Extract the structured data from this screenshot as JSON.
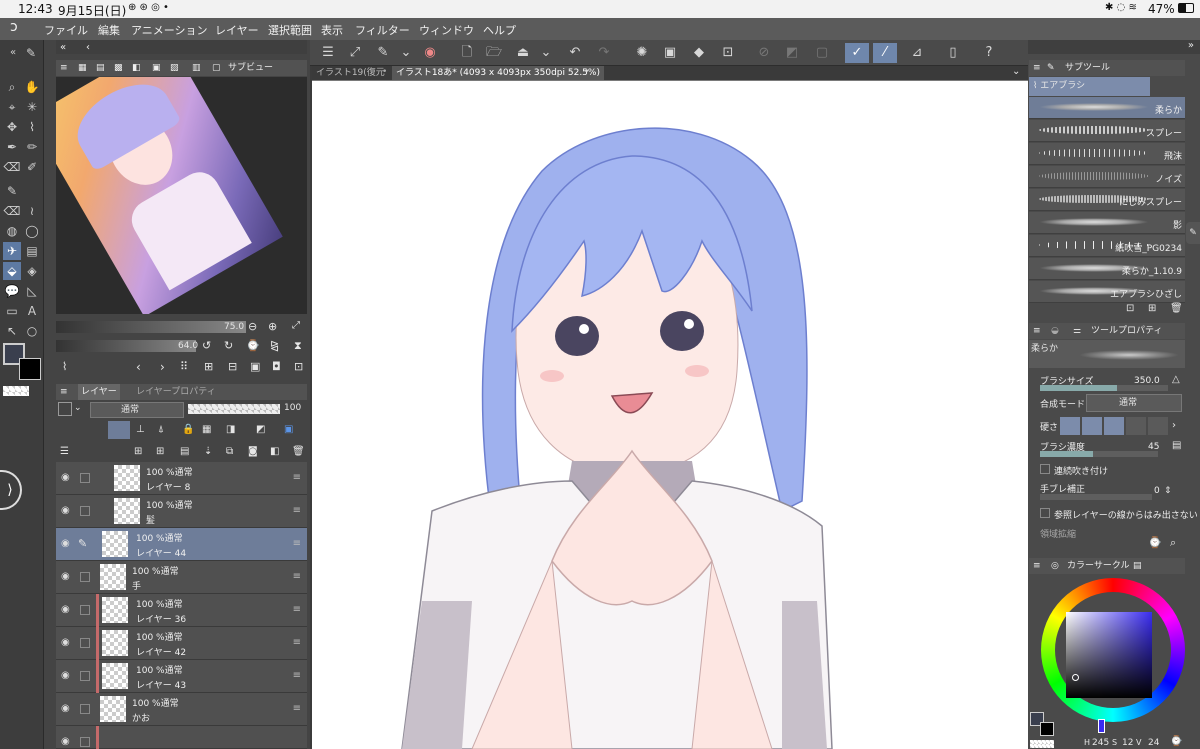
{
  "status_bar": {
    "time": "12:43",
    "date": "9月15日(日)",
    "battery": "47%"
  },
  "menu": [
    "ファイル",
    "編集",
    "アニメーション",
    "レイヤー",
    "選択範囲",
    "表示",
    "フィルター",
    "ウィンドウ",
    "ヘルプ"
  ],
  "canvas_tabs": [
    {
      "label": "イラスト19(復元",
      "active": false
    },
    {
      "label": "イラスト18あ* (4093 x 4093px 350dpi 52.5%)",
      "active": true
    }
  ],
  "subview": {
    "title": "サブビュー"
  },
  "navigator": {
    "zoom": "75.0",
    "rotate": "64.0"
  },
  "layer_panel": {
    "tab_layer": "レイヤー",
    "tab_layer_property": "レイヤープロパティ",
    "blend_mode": "通常",
    "opacity": "100",
    "layers": [
      {
        "mode": "100 %通常",
        "name": "レイヤー 8",
        "selected": false,
        "red": false
      },
      {
        "mode": "100 %通常",
        "name": "髪",
        "selected": false,
        "red": false
      },
      {
        "mode": "100 %通常",
        "name": "レイヤー 44",
        "selected": true,
        "red": false
      },
      {
        "mode": "100 %通常",
        "name": "手",
        "selected": false,
        "red": false
      },
      {
        "mode": "100 %通常",
        "name": "レイヤー 36",
        "selected": false,
        "red": true
      },
      {
        "mode": "100 %通常",
        "name": "レイヤー 42",
        "selected": false,
        "red": true
      },
      {
        "mode": "100 %通常",
        "name": "レイヤー 43",
        "selected": false,
        "red": true
      },
      {
        "mode": "100 %通常",
        "name": "かお",
        "selected": false,
        "red": false
      }
    ]
  },
  "subtool": {
    "title": "サブツール",
    "group": "エアブラシ",
    "brushes": [
      "柔らか",
      "スプレー",
      "飛沫",
      "ノイズ",
      "にじみスプレー",
      "影",
      "紙吹雪_PG0234",
      "柔らか_1.10.9",
      "エアブラシひざし"
    ]
  },
  "tool_property": {
    "title": "ツールプロパティ",
    "preset": "柔らか",
    "brush_size_label": "ブラシサイズ",
    "brush_size": "350.0",
    "blend_label": "合成モード",
    "blend_value": "通常",
    "hardness_label": "硬さ",
    "density_label": "ブラシ濃度",
    "density": "45",
    "continuous_label": "連続吹き付け",
    "stabilize_label": "手ブレ補正",
    "stabilize": "0",
    "ref_layer_label": "参照レイヤーの線からはみ出さない",
    "area_label": "領域拡縮"
  },
  "color_circle": {
    "title": "カラーサークル",
    "h": "245",
    "s": "12",
    "v": "24"
  },
  "colors": {
    "accent": "#6f87ac",
    "hair": "#8fa3e6",
    "selected_layer": "#6e7d99"
  }
}
